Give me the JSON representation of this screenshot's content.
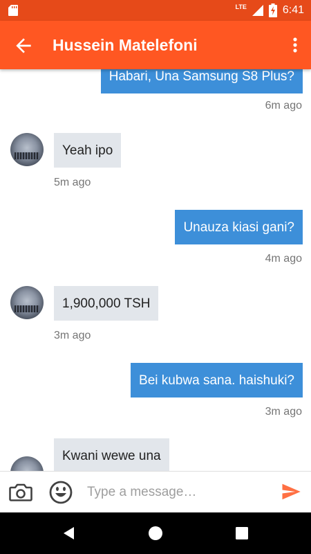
{
  "status_bar": {
    "network": "LTE",
    "battery_icon": "battery-charging-icon",
    "time": "6:41"
  },
  "header": {
    "title": "Hussein Matelefoni",
    "back_icon": "arrow-back-icon",
    "menu_icon": "more-vert-icon"
  },
  "messages": [
    {
      "side": "sent",
      "text": "Habari, Una Samsung S8 Plus?",
      "time": "6m ago"
    },
    {
      "side": "recv",
      "text": "Yeah ipo",
      "time": "5m ago"
    },
    {
      "side": "sent",
      "text": "Unauza kiasi gani?",
      "time": "4m ago"
    },
    {
      "side": "recv",
      "text": "1,900,000 TSH",
      "time": "3m ago"
    },
    {
      "side": "sent",
      "text": "Bei kubwa sana. haishuki?",
      "time": "3m ago"
    },
    {
      "side": "recv",
      "text": "Kwani wewe una",
      "time": ""
    }
  ],
  "input": {
    "placeholder": "Type a message…"
  },
  "colors": {
    "status_bar": "#e64a19",
    "app_bar": "#ff5722",
    "sent_bubble": "#3d8fd9",
    "received_bubble": "#e2e6eb",
    "send_icon": "#ff7043"
  }
}
